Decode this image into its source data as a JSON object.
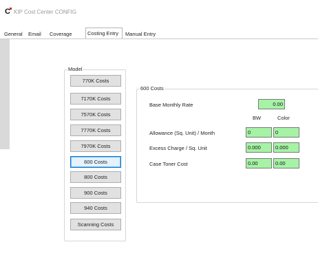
{
  "window": {
    "title": "KIP Cost Center CONFIG",
    "icon": "app-logo-icon"
  },
  "tabs": [
    {
      "label": "General"
    },
    {
      "label": "Email"
    },
    {
      "label": "Coverage"
    },
    {
      "label": "Costing Entry",
      "active": true
    },
    {
      "label": "Manual Entry"
    }
  ],
  "model": {
    "legend": "Model",
    "selected": "600 Costs",
    "buttons": [
      {
        "label": "770K Costs"
      },
      {
        "label": "7170K Costs"
      },
      {
        "label": "7570K Costs"
      },
      {
        "label": "7770K Costs"
      },
      {
        "label": "7970K Costs"
      },
      {
        "label": "600 Costs"
      },
      {
        "label": "800 Costs"
      },
      {
        "label": "900 Costs"
      },
      {
        "label": "940 Costs"
      },
      {
        "label": "Scanning Costs"
      }
    ]
  },
  "costs": {
    "legend": "600 Costs",
    "base_monthly_rate": {
      "label": "Base Monthly Rate",
      "value": "0.00"
    },
    "columns": {
      "bw": "BW",
      "color": "Color"
    },
    "allowance": {
      "label": "Allowance (Sq. Unit) / Month",
      "bw": "0",
      "color": "0"
    },
    "excess": {
      "label": "Excess Charge / Sq. Unit",
      "bw": "0.000",
      "color": "0.000"
    },
    "toner": {
      "label": "Case Toner Cost",
      "bw": "0.00",
      "color": "0.00"
    }
  },
  "colors": {
    "field_bg": "#a6f3a6",
    "selected_border": "#0078d7",
    "button_bg": "#e1e1e1"
  }
}
